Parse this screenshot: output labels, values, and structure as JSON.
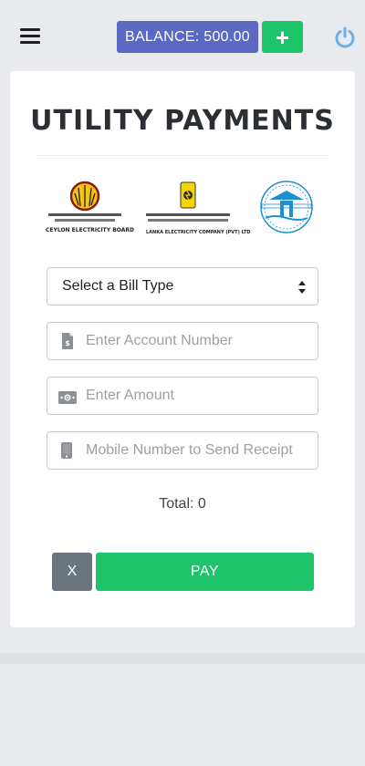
{
  "header": {
    "balance_label": "BALANCE: 500.00",
    "add_label": "+",
    "menu_icon": "hamburger-menu-icon",
    "power_icon": "power-icon"
  },
  "page": {
    "title": "UTILITY PAYMENTS"
  },
  "providers": [
    {
      "name": "Ceylon Electricity Board",
      "caption": "CEYLON ELECTRICITY BOARD"
    },
    {
      "name": "Lanka Electricity Company",
      "caption": "LANKA ELECTRICITY COMPANY (PVT) LTD"
    },
    {
      "name": "Water Board",
      "caption": ""
    }
  ],
  "form": {
    "bill_type": {
      "selected": "Select a Bill Type"
    },
    "account_number": {
      "placeholder": "Enter Account Number",
      "value": ""
    },
    "amount": {
      "placeholder": "Enter Amount",
      "value": ""
    },
    "mobile": {
      "placeholder": "Mobile Number to Send Receipt",
      "value": ""
    },
    "total_label": "Total: 0"
  },
  "actions": {
    "cancel_label": "X",
    "pay_label": "PAY"
  },
  "colors": {
    "balance_button": "#5b68c4",
    "accent_green": "#1ec469",
    "cancel_gray": "#6c757d",
    "power_blue": "#6ab0e8",
    "background": "#e8eaee"
  }
}
